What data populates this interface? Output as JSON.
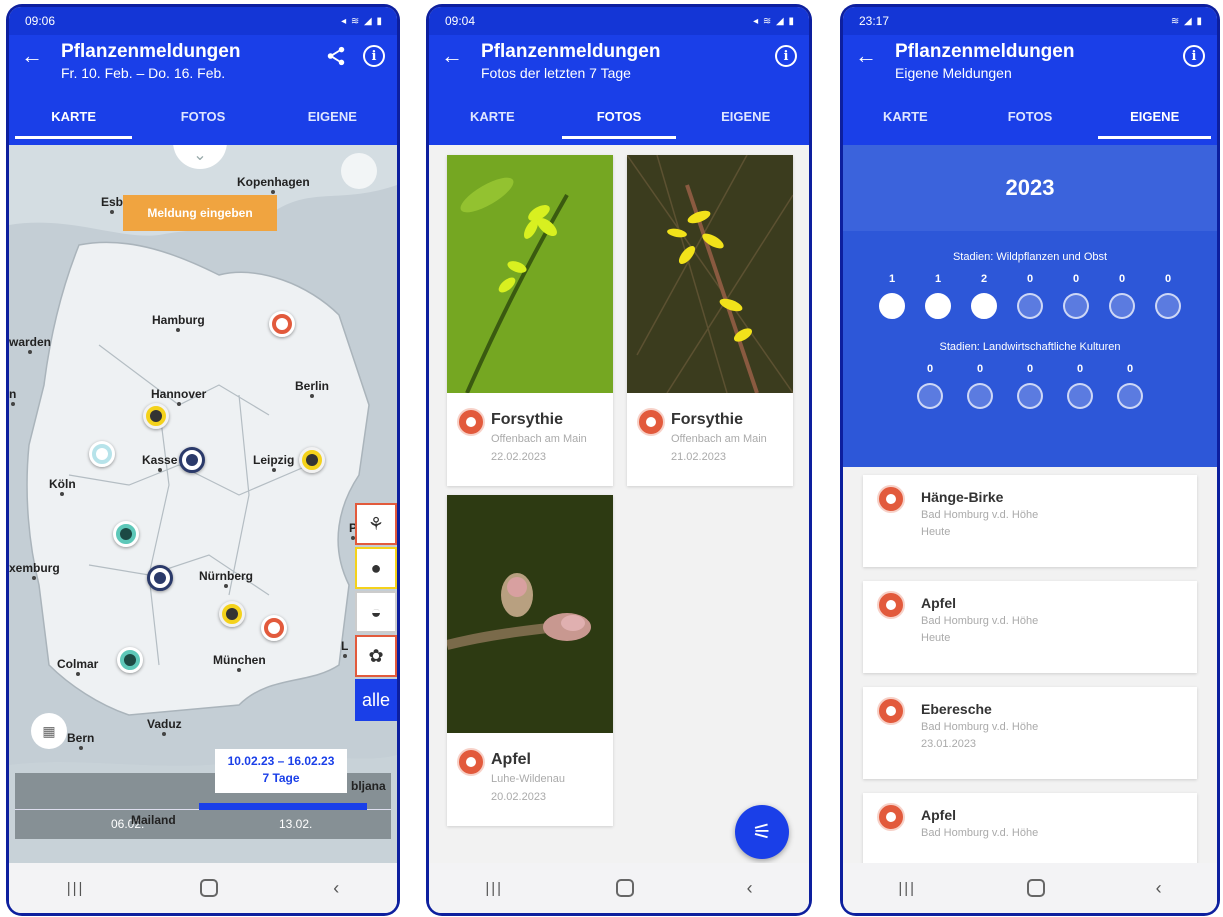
{
  "phone1": {
    "status": {
      "time": "09:06",
      "icons": "◂ ≋ ◢ ▮"
    },
    "header": {
      "back": "←",
      "title": "Pflanzenmeldungen",
      "subtitle": "Fr. 10. Feb. – Do. 16. Feb."
    },
    "tabs": [
      "KARTE",
      "FOTOS",
      "EIGENE"
    ],
    "map": {
      "report_button": "Meldung eingeben",
      "cities": {
        "esb": "Esb",
        "kopenhagen": "Kopenhagen",
        "hamburg": "Hamburg",
        "warden": "warden",
        "hannover": "Hannover",
        "berlin": "Berlin",
        "kassel": "Kasse",
        "leipzig": "Leipzig",
        "koeln": "Köln",
        "xemburg": "xemburg",
        "nuernberg": "Nürnberg",
        "colmar": "Colmar",
        "muenchen": "München",
        "vaduz": "Vaduz",
        "bern": "Bern",
        "bljana": "bljana",
        "n": "n",
        "p": "P",
        "l": "L"
      },
      "filter_all": "alle",
      "time_range": "10.02.23 – 16.02.23",
      "time_days": "7 Tage",
      "timeline_left": "06.02.",
      "timeline_mid": "Mailand",
      "timeline_right": "13.02."
    },
    "nav": {
      "recent": "|||",
      "back": "‹"
    }
  },
  "phone2": {
    "status": {
      "time": "09:04",
      "icons": "◂ ≋ ◢ ▮"
    },
    "header": {
      "back": "←",
      "title": "Pflanzenmeldungen",
      "subtitle": "Fotos der letzten 7 Tage"
    },
    "tabs": [
      "KARTE",
      "FOTOS",
      "EIGENE"
    ],
    "photos": [
      {
        "name": "Forsythie",
        "place": "Offenbach am Main",
        "date": "22.02.2023"
      },
      {
        "name": "Forsythie",
        "place": "Offenbach am Main",
        "date": "21.02.2023"
      },
      {
        "name": "Apfel",
        "place": "Luhe-Wildenau",
        "date": "20.02.2023"
      }
    ],
    "nav": {
      "recent": "|||",
      "back": "‹"
    }
  },
  "phone3": {
    "status": {
      "time": "23:17",
      "icons": "≋ ◢ ▮"
    },
    "header": {
      "back": "←",
      "title": "Pflanzenmeldungen",
      "subtitle": "Eigene Meldungen"
    },
    "tabs": [
      "KARTE",
      "FOTOS",
      "EIGENE"
    ],
    "year": "2023",
    "wild_heading": "Stadien: Wildpflanzen und Obst",
    "wild_counts": [
      "1",
      "1",
      "2",
      "0",
      "0",
      "0",
      "0"
    ],
    "agri_heading": "Stadien: Landwirtschaftliche Kulturen",
    "agri_counts": [
      "0",
      "0",
      "0",
      "0",
      "0"
    ],
    "reports": [
      {
        "name": "Hänge-Birke",
        "place": "Bad Homburg v.d. Höhe",
        "date": "Heute"
      },
      {
        "name": "Apfel",
        "place": "Bad Homburg v.d. Höhe",
        "date": "Heute"
      },
      {
        "name": "Eberesche",
        "place": "Bad Homburg v.d. Höhe",
        "date": "23.01.2023"
      },
      {
        "name": "Apfel",
        "place": "Bad Homburg v.d. Höhe",
        "date": ""
      }
    ],
    "nav": {
      "recent": "|||",
      "back": "‹"
    }
  },
  "colors": {
    "primary": "#1a3fe8",
    "stage_red": "#e25a3c",
    "stage_yellow": "#f4d21b",
    "stage_teal": "#5ec8b9",
    "report_orange": "#f0a440"
  }
}
